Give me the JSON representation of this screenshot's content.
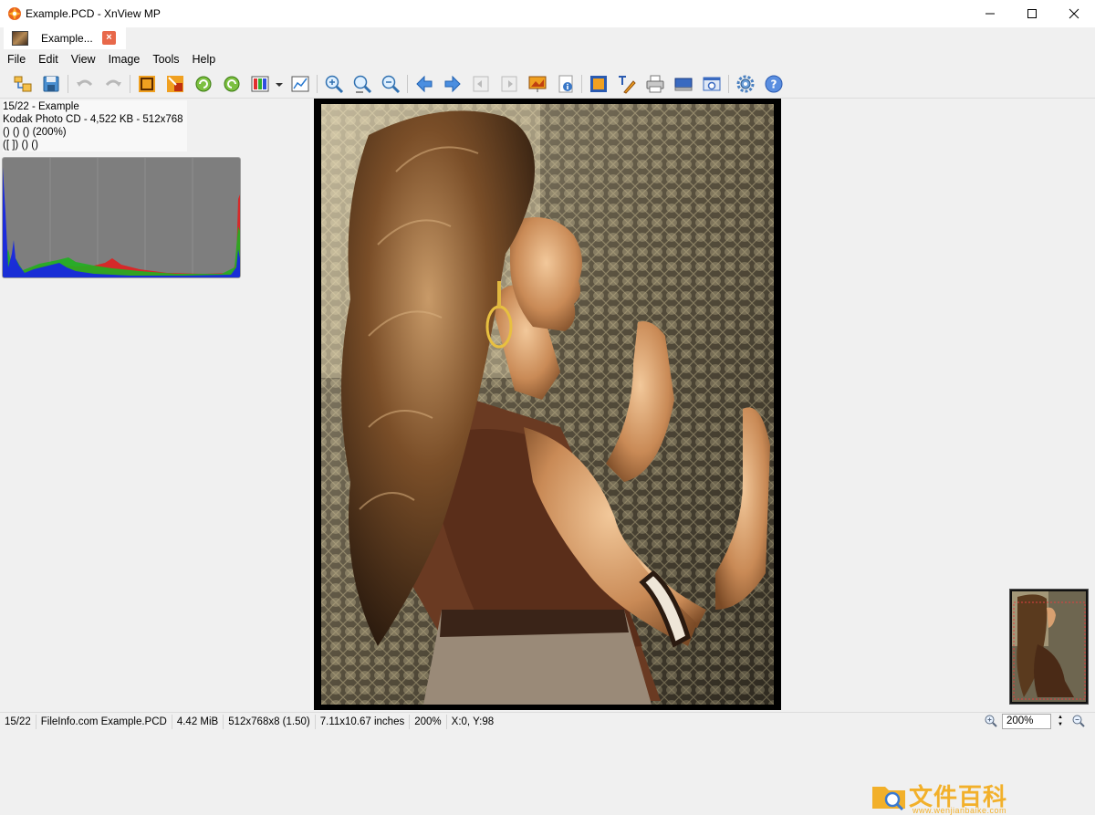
{
  "window": {
    "title": "Example.PCD - XnView MP"
  },
  "tab": {
    "label": "Example...",
    "close_glyph": "×"
  },
  "menu": [
    {
      "label": "File"
    },
    {
      "label": "Edit"
    },
    {
      "label": "View"
    },
    {
      "label": "Image"
    },
    {
      "label": "Tools"
    },
    {
      "label": "Help"
    }
  ],
  "toolbar": {
    "buttons": [
      {
        "name": "browser-icon"
      },
      {
        "name": "save-icon"
      },
      {
        "name": "undo-icon"
      },
      {
        "name": "redo-icon"
      },
      {
        "name": "crop-icon"
      },
      {
        "name": "resize-icon"
      },
      {
        "name": "rotate-left-icon"
      },
      {
        "name": "rotate-right-icon"
      },
      {
        "name": "adjust-colors-icon"
      },
      {
        "name": "dropdown-arrow-icon"
      },
      {
        "name": "levels-icon"
      },
      {
        "name": "zoom-in-icon"
      },
      {
        "name": "zoom-actual-icon"
      },
      {
        "name": "zoom-out-icon"
      },
      {
        "name": "previous-icon"
      },
      {
        "name": "next-icon"
      },
      {
        "name": "first-icon"
      },
      {
        "name": "last-icon"
      },
      {
        "name": "slideshow-icon"
      },
      {
        "name": "properties-icon"
      },
      {
        "name": "fullscreen-icon"
      },
      {
        "name": "text-edit-icon"
      },
      {
        "name": "print-icon"
      },
      {
        "name": "scan-icon"
      },
      {
        "name": "capture-icon"
      },
      {
        "name": "settings-icon"
      },
      {
        "name": "help-icon"
      }
    ]
  },
  "info_overlay": {
    "line1": "15/22 - Example",
    "line2": "Kodak Photo CD - 4,522 KB - 512x768",
    "line3": "() () () (200%)",
    "line4": "([ ]) () ()"
  },
  "histogram": {
    "channels": [
      "red",
      "green",
      "blue"
    ],
    "colors": {
      "red": "#ff2020",
      "green": "#20c020",
      "blue": "#2030e0",
      "background": "#7e7e7e"
    }
  },
  "status": {
    "index": "15/22",
    "file": "FileInfo.com Example.PCD",
    "size": "4.42 MiB",
    "dims": "512x768x8 (1.50)",
    "print_size": "7.11x10.67 inches",
    "zoom": "200%",
    "coords": "X:0, Y:98"
  },
  "zoom_control": {
    "value": "200%"
  },
  "watermark": {
    "text": "文件百科",
    "url": "www.wenjianbaike.com"
  }
}
